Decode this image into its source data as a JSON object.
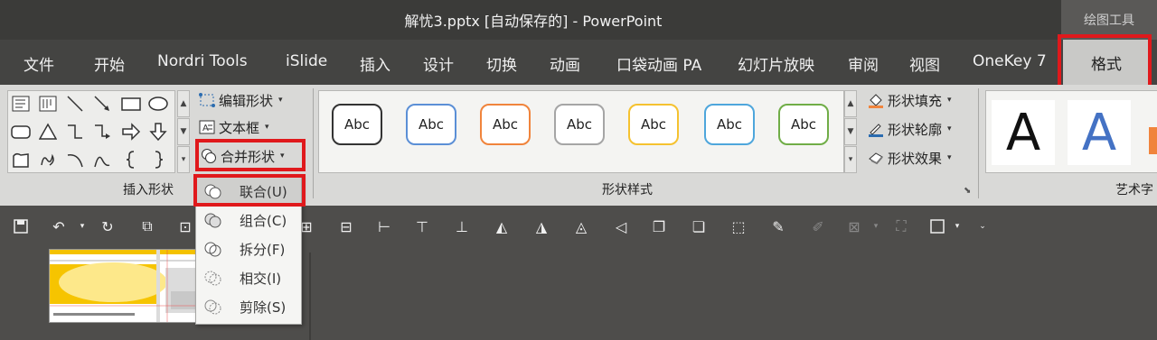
{
  "window": {
    "title": "解忧3.pptx [自动保存的] - PowerPoint",
    "context_label": "绘图工具"
  },
  "tabs": [
    {
      "label": "文件"
    },
    {
      "label": "开始"
    },
    {
      "label": "Nordri Tools"
    },
    {
      "label": "iSlide"
    },
    {
      "label": "插入"
    },
    {
      "label": "设计"
    },
    {
      "label": "切换"
    },
    {
      "label": "动画"
    },
    {
      "label": "口袋动画 PA"
    },
    {
      "label": "幻灯片放映"
    },
    {
      "label": "审阅"
    },
    {
      "label": "视图"
    },
    {
      "label": "OneKey 7"
    },
    {
      "label": "格式",
      "active": true
    }
  ],
  "insert_shapes": {
    "group_label": "插入形状",
    "edit_shape": "编辑形状",
    "text_box": "文本框",
    "merge_shapes": "合并形状",
    "shape_icons": [
      "text-box-icon",
      "vertical-text-box-icon",
      "line-icon",
      "arrow-line-icon",
      "rectangle-icon",
      "oval-icon",
      "rounded-rectangle-icon",
      "triangle-icon",
      "elbow-connector-icon",
      "elbow-arrow-connector-icon",
      "right-arrow-icon",
      "down-arrow-icon",
      "freeform-icon",
      "scribble-icon",
      "arc-icon",
      "curve-icon",
      "left-brace-icon",
      "right-brace-icon"
    ]
  },
  "shape_styles": {
    "group_label": "形状样式",
    "swatches": [
      {
        "label": "Abc",
        "color": "#333333"
      },
      {
        "label": "Abc",
        "color": "#5b8fd6"
      },
      {
        "label": "Abc",
        "color": "#f0843c"
      },
      {
        "label": "Abc",
        "color": "#a5a5a5"
      },
      {
        "label": "Abc",
        "color": "#f5c230"
      },
      {
        "label": "Abc",
        "color": "#4ea6dc"
      },
      {
        "label": "Abc",
        "color": "#70ad47"
      }
    ],
    "fill": "形状填充",
    "outline": "形状轮廓",
    "effects": "形状效果"
  },
  "wordart": {
    "group_label": "艺术字",
    "letters": [
      {
        "text": "A",
        "color": "#111111"
      },
      {
        "text": "A",
        "color": "#4472c4"
      }
    ]
  },
  "merge_menu": {
    "items": [
      {
        "label": "联合(U)",
        "hover": true
      },
      {
        "label": "组合(C)"
      },
      {
        "label": "拆分(F)"
      },
      {
        "label": "相交(I)"
      },
      {
        "label": "剪除(S)"
      }
    ]
  },
  "colors": {
    "highlight": "#e0191c"
  }
}
